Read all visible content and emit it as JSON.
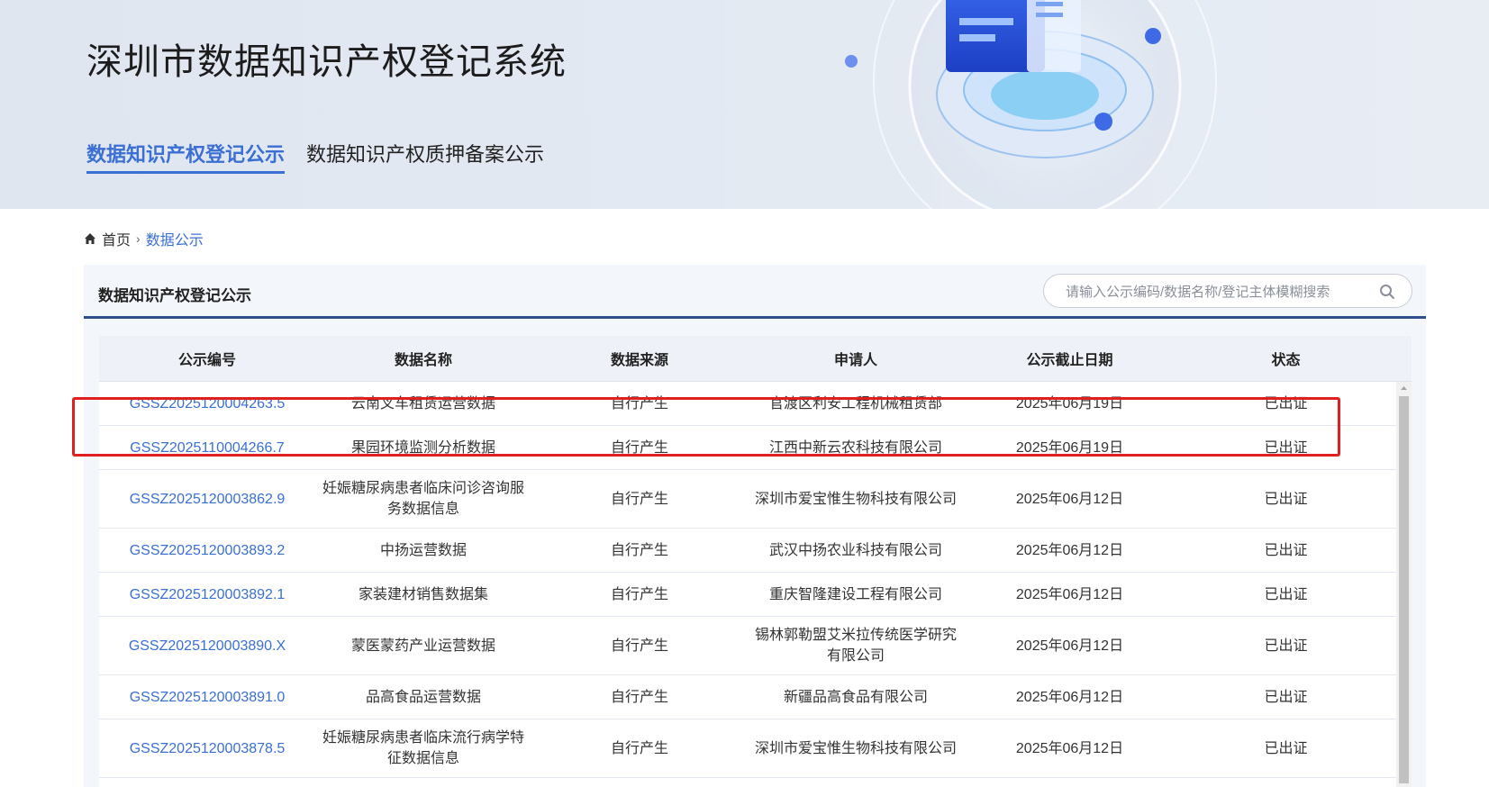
{
  "header": {
    "site_title": "深圳市数据知识产权登记系统",
    "tabs": [
      {
        "label": "数据知识产权登记公示",
        "active": true
      },
      {
        "label": "数据知识产权质押备案公示",
        "active": false
      }
    ]
  },
  "breadcrumb": {
    "home": "首页",
    "separator": "›",
    "current": "数据公示"
  },
  "panel": {
    "title": "数据知识产权登记公示",
    "search_placeholder": "请输入公示编码/数据名称/登记主体模糊搜索"
  },
  "table": {
    "columns": [
      "公示编号",
      "数据名称",
      "数据来源",
      "申请人",
      "公示截止日期",
      "状态"
    ],
    "rows": [
      {
        "code": "GSSZ2025120004263.5",
        "name": "云南叉车租赁运营数据",
        "source": "自行产生",
        "applicant": "官渡区利安工程机械租赁部",
        "deadline": "2025年06月19日",
        "status": "已出证"
      },
      {
        "code": "GSSZ2025110004266.7",
        "name": "果园环境监测分析数据",
        "source": "自行产生",
        "applicant": "江西中新云农科技有限公司",
        "deadline": "2025年06月19日",
        "status": "已出证"
      },
      {
        "code": "GSSZ2025120003862.9",
        "name": "妊娠糖尿病患者临床问诊咨询服务数据信息",
        "source": "自行产生",
        "applicant": "深圳市爱宝惟生物科技有限公司",
        "deadline": "2025年06月12日",
        "status": "已出证"
      },
      {
        "code": "GSSZ2025120003893.2",
        "name": "中扬运营数据",
        "source": "自行产生",
        "applicant": "武汉中扬农业科技有限公司",
        "deadline": "2025年06月12日",
        "status": "已出证"
      },
      {
        "code": "GSSZ2025120003892.1",
        "name": "家装建材销售数据集",
        "source": "自行产生",
        "applicant": "重庆智隆建设工程有限公司",
        "deadline": "2025年06月12日",
        "status": "已出证"
      },
      {
        "code": "GSSZ2025120003890.X",
        "name": "蒙医蒙药产业运营数据",
        "source": "自行产生",
        "applicant": "锡林郭勒盟艾米拉传统医学研究有限公司",
        "deadline": "2025年06月12日",
        "status": "已出证"
      },
      {
        "code": "GSSZ2025120003891.0",
        "name": "品高食品运营数据",
        "source": "自行产生",
        "applicant": "新疆品高食品有限公司",
        "deadline": "2025年06月12日",
        "status": "已出证"
      },
      {
        "code": "GSSZ2025120003878.5",
        "name": "妊娠糖尿病患者临床流行病学特征数据信息",
        "source": "自行产生",
        "applicant": "深圳市爱宝惟生物科技有限公司",
        "deadline": "2025年06月12日",
        "status": "已出证"
      }
    ],
    "highlighted_row": 2
  },
  "colors": {
    "accent": "#3b6fd4",
    "header_rule": "#2f4f8c",
    "highlight": "#e02020"
  },
  "icons": [
    "home-icon",
    "search-icon",
    "scroll-up-icon"
  ]
}
